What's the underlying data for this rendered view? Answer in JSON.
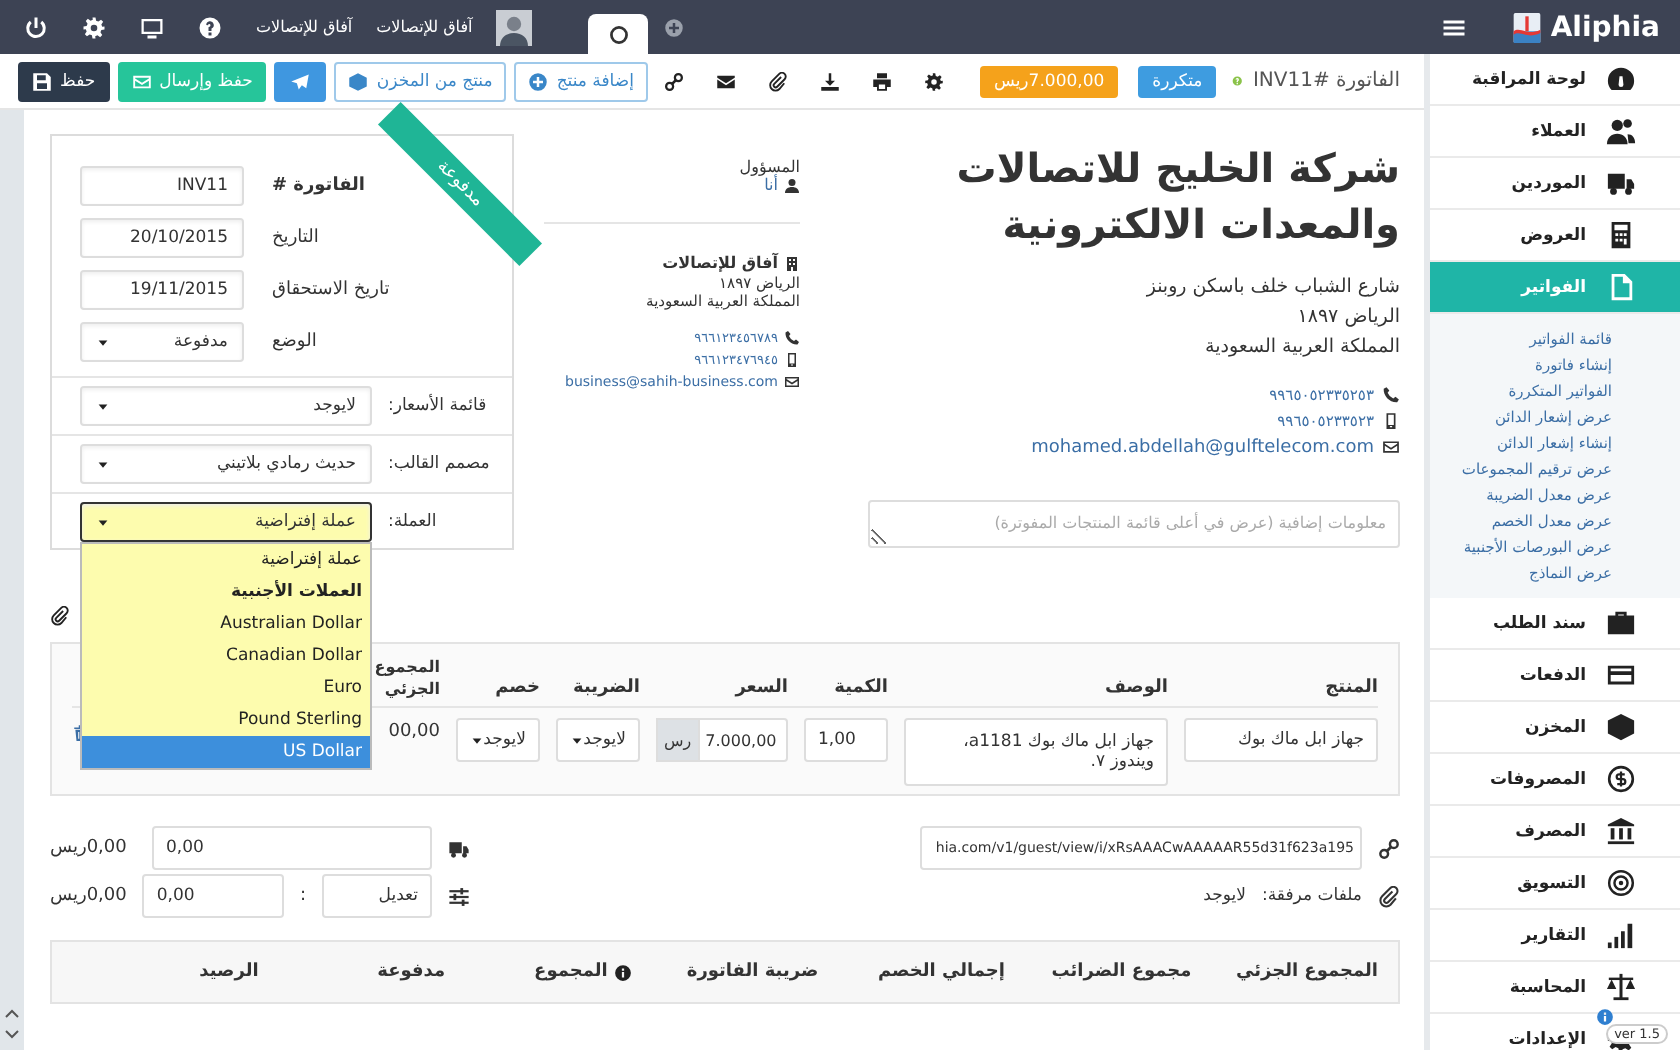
{
  "top_bar": {
    "company_label": "آفاق للإتصالات",
    "user_name": "آفاق للإتصالات"
  },
  "brand": {
    "name": "Aliphia"
  },
  "toolbar": {
    "buttons": [
      {
        "kind": "add",
        "label": "إضافة منتج"
      },
      {
        "kind": "stock",
        "label": "منتج من المخزن"
      },
      {
        "kind": "plane"
      },
      {
        "kind": "send",
        "label": "حفظ وإرسال"
      },
      {
        "kind": "save",
        "label": "حفظ"
      }
    ],
    "amount_badge": "7.000,00ريس",
    "recurring_badge": "متكررة",
    "invoice_title": "الفاتورة #INV11"
  },
  "invoice_card": {
    "status_ribbon": "مدفوعة",
    "fields": [
      {
        "kind": "input",
        "label": "الفاتورة #",
        "value": "INV11"
      },
      {
        "kind": "input",
        "label": "التاريخ",
        "value": "20/10/2015"
      },
      {
        "kind": "input",
        "label": "تاريخ الاستحقاق",
        "value": "19/11/2015"
      },
      {
        "kind": "select",
        "label": "الوضع",
        "value": "مدفوعة"
      }
    ],
    "options": [
      {
        "label": "قائمة الأسعار:",
        "value": "لايوجد",
        "open": false
      },
      {
        "label": "مصمم القالب:",
        "value": "حديث رمادي بلاتيني",
        "open": false
      },
      {
        "label": "العملة:",
        "value": "عملة إفتراضية",
        "open": true
      }
    ],
    "currency_menu": [
      {
        "kind": "option",
        "label": "عملة إفتراضية",
        "selected": false
      },
      {
        "kind": "group",
        "label": "العملات الأجنبية",
        "selected": false
      },
      {
        "kind": "option",
        "label": "Australian Dollar",
        "selected": false
      },
      {
        "kind": "option",
        "label": "Canadian Dollar",
        "selected": false
      },
      {
        "kind": "option",
        "label": "Euro",
        "selected": false
      },
      {
        "kind": "option",
        "label": "Pound Sterling",
        "selected": false
      },
      {
        "kind": "option",
        "label": "US Dollar",
        "selected": true
      }
    ]
  },
  "sender": {
    "owner_label": "المسؤول",
    "owner_value": "أنا",
    "company": "آفاق للإتصالات",
    "address": [
      "الرياض ١٨٩٧",
      "المملكة العربية السعودية"
    ],
    "phone": "٩٦٦١٢٣٤٥٦٧٨٩",
    "mobile": "٩٦٦١٢٣٤٧٦٩٤٥",
    "email": "business@sahih-business.com"
  },
  "client": {
    "name": "شركة الخليج للاتصالات والمعدات الالكترونية",
    "address": [
      "شارع الشباب خلف باسكن روبنز",
      "الرياض ١٨٩٧",
      "المملكة العربية السعودية"
    ],
    "phone": "٩٩٦٥٠٥٢٣٣٥٢٥٣",
    "mobile": "٩٩٦٥٠٥٢٣٣٥٢٣",
    "email": "mohamed.abdellah@gulftelecom.com",
    "notes_placeholder": "معلومات إضافية (عرض في أعلى قائمة المنتجات المفوترة)"
  },
  "items": {
    "columns": [
      "المنتج",
      "الوصف",
      "الكمية",
      "السعر",
      "الضريبة",
      "خصم",
      "المجموع الجزئي"
    ],
    "rows": [
      {
        "product": "جهاز ابل ماك بوك",
        "description": "جهاز ابل ماك بوك a1181، ويندوز ٧.",
        "quantity": "1,00",
        "price": "7.000,00",
        "currency": "رس",
        "tax": "لايوجد",
        "discount": "لايوجد",
        "subtotal": "00,00"
      }
    ]
  },
  "extras": {
    "link_url": "hia.com/v1/guest/view/i/xRsAAACwAAAAAR55d31f623a195",
    "attachments_label": "ملفات مرفقة:",
    "attachments_value": "لايوجد",
    "shipping_value": "0,00",
    "shipping_total": "0,00ريس",
    "adjust_label": "تعديل",
    "adjust_separator": ":",
    "adjust_value": "0,00",
    "adjust_total": "0,00ريس"
  },
  "totals": {
    "columns": [
      "المجموع الجزئي",
      "مجموع الضرائب",
      "إجمالي الخصم",
      "ضريبة الفاتورة",
      "المجموع",
      "مدفوعة",
      "الرصيد"
    ]
  },
  "sidebar": {
    "items": [
      {
        "label": "لوحة المراقبة",
        "selected": false
      },
      {
        "label": "العملاء",
        "selected": false
      },
      {
        "label": "الموردين",
        "selected": false
      },
      {
        "label": "العروض",
        "selected": false
      },
      {
        "label": "الفواتير",
        "selected": true,
        "children": [
          "قائمة الفواتير",
          "إنشاء فاتورة",
          "الفواتير المتكررة",
          "عرض إشعار الدائن",
          "إنشاء إشعار الدائن",
          "عرض ترقيم المجموعات",
          "عرض معدل الضريبة",
          "عرض معدل الخصم",
          "عرض البورصات الأجنبية",
          "عرض النماذج"
        ]
      },
      {
        "label": "سند الطلب",
        "selected": false
      },
      {
        "label": "الدفعات",
        "selected": false
      },
      {
        "label": "المخزن",
        "selected": false
      },
      {
        "label": "المصروفات",
        "selected": false
      },
      {
        "label": "المصرف",
        "selected": false
      },
      {
        "label": "التسويق",
        "selected": false
      },
      {
        "label": "التقارير",
        "selected": false
      },
      {
        "label": "المحاسبة",
        "selected": false
      },
      {
        "label": "الإعدادات",
        "selected": false
      }
    ],
    "version": "ver 1.5"
  }
}
